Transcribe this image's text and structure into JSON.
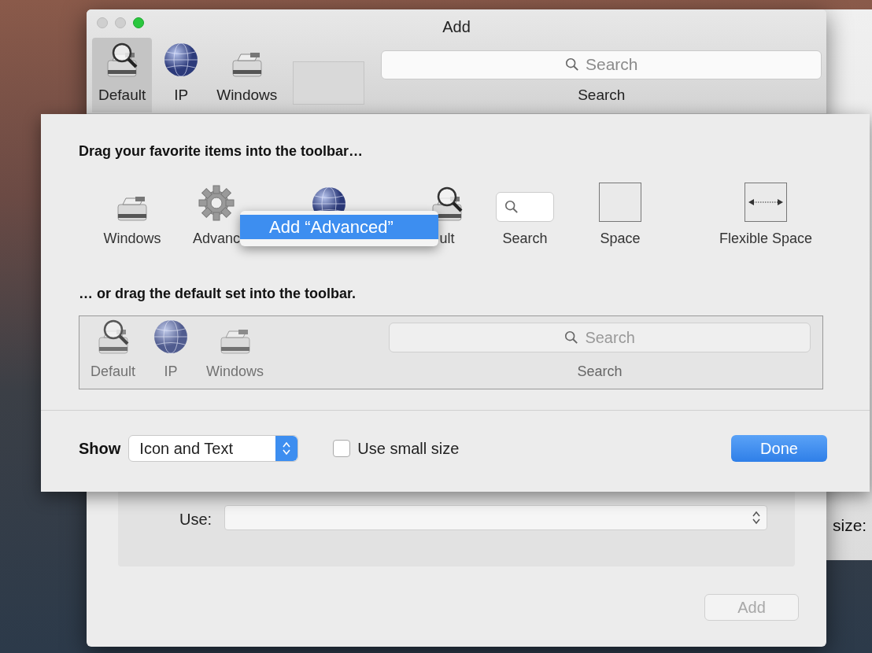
{
  "window": {
    "title": "Add",
    "toolbar": [
      {
        "kind": "magnifier",
        "label": "Default",
        "selected": true
      },
      {
        "kind": "globe",
        "label": "IP",
        "selected": false
      },
      {
        "kind": "printer",
        "label": "Windows",
        "selected": false
      },
      {
        "kind": "space"
      },
      {
        "kind": "search",
        "placeholder": "Search",
        "label": "Search"
      }
    ]
  },
  "customize_sheet": {
    "heading": "Drag your favorite items into the toolbar…",
    "items": [
      {
        "kind": "printer",
        "label": "Windows"
      },
      {
        "kind": "gear",
        "label": "Advanc"
      },
      {
        "kind": "globe"
      },
      {
        "kind": "magnifier",
        "label": "ult"
      },
      {
        "kind": "search",
        "label": "Search"
      },
      {
        "kind": "space",
        "label": "Space"
      },
      {
        "kind": "flexible",
        "label": "Flexible Space"
      }
    ],
    "context_menu": {
      "items": [
        {
          "label": "Add “Advanced”",
          "selected": true
        }
      ]
    },
    "default_heading": "… or drag the default set into the toolbar.",
    "default_set": [
      {
        "kind": "magnifier",
        "label": "Default"
      },
      {
        "kind": "globe",
        "label": "IP"
      },
      {
        "kind": "printer",
        "label": "Windows"
      },
      {
        "kind": "search",
        "placeholder": "Search",
        "label": "Search"
      }
    ],
    "show_label": "Show",
    "show_popup": "Icon and Text",
    "small_size": {
      "label": "Use small size",
      "checked": false
    },
    "done_button": "Done"
  },
  "background": {
    "use_label": "Use:",
    "add_button": {
      "label": "Add",
      "disabled": true
    },
    "other_window_label": "size:"
  }
}
